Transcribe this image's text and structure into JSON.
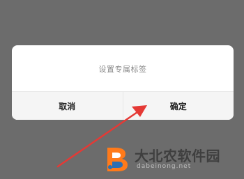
{
  "dialog": {
    "message": "设置专属标签",
    "cancel_label": "取消",
    "confirm_label": "确定"
  },
  "watermark": {
    "site_name": "大北农软件园",
    "site_domain": "dabeinong.net"
  },
  "colors": {
    "backdrop": "#6c6c6c",
    "dialog_bg": "#ffffff",
    "button_bar_bg": "#f2f2f2",
    "annotation_arrow": "#e53935",
    "logo_orange": "#ff7a1a",
    "logo_blue": "#2c6fb3"
  },
  "icons": {
    "annotation": "red-pointer-arrow-icon",
    "watermark_logo": "dabeinong-logo-icon"
  }
}
